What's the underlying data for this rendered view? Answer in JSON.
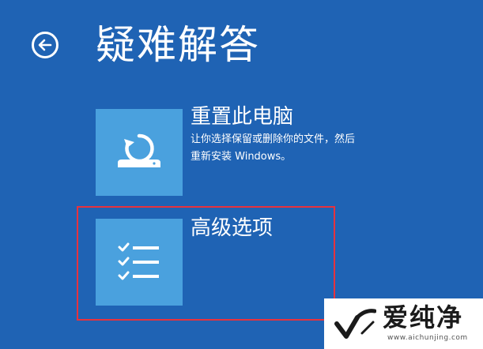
{
  "header": {
    "title": "疑难解答",
    "back_icon": "back-arrow-icon"
  },
  "options": [
    {
      "title": "重置此电脑",
      "desc_line1": "让你选择保留或删除你的文件，然后",
      "desc_line2": "重新安装 Windows。",
      "icon": "reset-pc-icon"
    },
    {
      "title": "高级选项",
      "icon": "checklist-icon"
    }
  ],
  "watermark": {
    "brand": "爱纯净",
    "url": "www.aichunjing.com"
  },
  "colors": {
    "background": "#1f63b4",
    "tile": "#4aa1de",
    "highlight": "#e8323d"
  }
}
